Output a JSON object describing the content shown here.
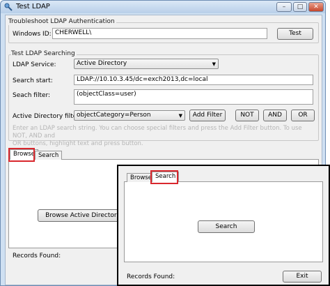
{
  "window": {
    "title": "Test LDAP",
    "min": "–",
    "max": "□",
    "close": "✕"
  },
  "troubleshoot": {
    "title": "Troubleshoot LDAP Authentication",
    "windows_id_label": "Windows ID:",
    "windows_id_value": "CHERWELL\\",
    "test_button": "Test"
  },
  "searching": {
    "title": "Test LDAP Searching",
    "service_label": "LDAP Service:",
    "service_value": "Active Directory",
    "search_start_label": "Search start:",
    "search_start_value": "LDAP://10.10.3.45/dc=exch2013,dc=local",
    "search_filter_label": "Seach filter:",
    "search_filter_value": "(objectClass=user)",
    "ad_filters_label": "Active Directory filters:",
    "ad_filters_value": "objectCategory=Person",
    "add_filter_button": "Add Filter",
    "not_button": "NOT",
    "and_button": "AND",
    "or_button": "OR",
    "hint_line1": "Enter an LDAP search string. You can choose special filters and press the Add Filter button. To use NOT, AND and",
    "hint_line2": "OR buttons, highlight text and press button."
  },
  "tabs": {
    "browse": "Browse",
    "search": "Search"
  },
  "browse_panel": {
    "browse_ad_button": "Browse Active Directory"
  },
  "records_label": "Records Found:",
  "inset": {
    "browse_tab": "Browse",
    "search_tab": "Search",
    "search_button": "Search",
    "records_label": "Records Found:",
    "exit_button": "Exit"
  },
  "colors": {
    "highlight_box": "#d9272d",
    "window_frame": "#cfe0f2"
  }
}
